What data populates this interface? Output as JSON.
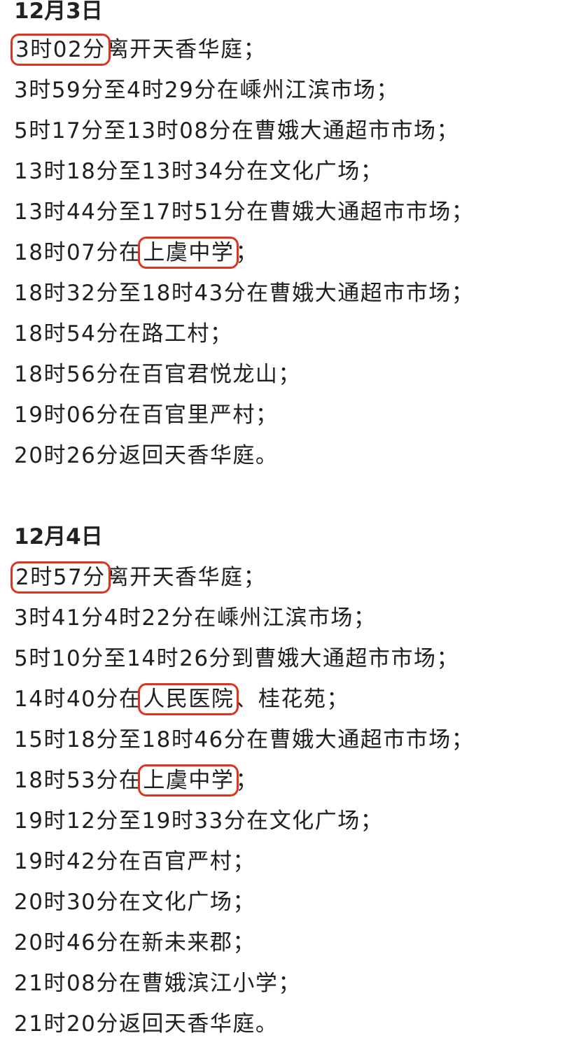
{
  "sections": [
    {
      "date": "12月3日",
      "lines": [
        {
          "hl": "3时02分",
          "rest": "离开天香华庭；"
        },
        {
          "text": "3时59分至4时29分在嵊州江滨市场；"
        },
        {
          "text": "5时17分至13时08分在曹娥大通超市市场；"
        },
        {
          "text": "13时18分至13时34分在文化广场；"
        },
        {
          "text": "13时44分至17时51分在曹娥大通超市市场；"
        },
        {
          "pre": "18时07分在",
          "hl": "上虞中学",
          "rest": "；"
        },
        {
          "text": "18时32分至18时43分在曹娥大通超市市场；"
        },
        {
          "text": "18时54分在路工村；"
        },
        {
          "text": "18时56分在百官君悦龙山；"
        },
        {
          "text": "19时06分在百官里严村；"
        },
        {
          "text": "20时26分返回天香华庭。"
        }
      ]
    },
    {
      "date": "12月4日",
      "lines": [
        {
          "hl": "2时57分",
          "rest": "离开天香华庭；"
        },
        {
          "text": "3时41分4时22分在嵊州江滨市场；"
        },
        {
          "text": "5时10分至14时26分到曹娥大通超市市场；"
        },
        {
          "pre": "14时40分在",
          "hl": "人民医院",
          "rest": "、桂花苑；"
        },
        {
          "text": "15时18分至18时46分在曹娥大通超市市场；"
        },
        {
          "pre": "18时53分在",
          "hl": "上虞中学",
          "rest": "；"
        },
        {
          "text": "19时12分至19时33分在文化广场；"
        },
        {
          "text": "19时42分在百官严村；"
        },
        {
          "text": "20时30分在文化广场；"
        },
        {
          "text": "20时46分在新未来郡；"
        },
        {
          "text": "21时08分在曹娥滨江小学；"
        },
        {
          "text": "21时20分返回天香华庭。"
        }
      ]
    }
  ],
  "colors": {
    "highlight_border": "#e0321c",
    "text": "#1f1f1f"
  }
}
